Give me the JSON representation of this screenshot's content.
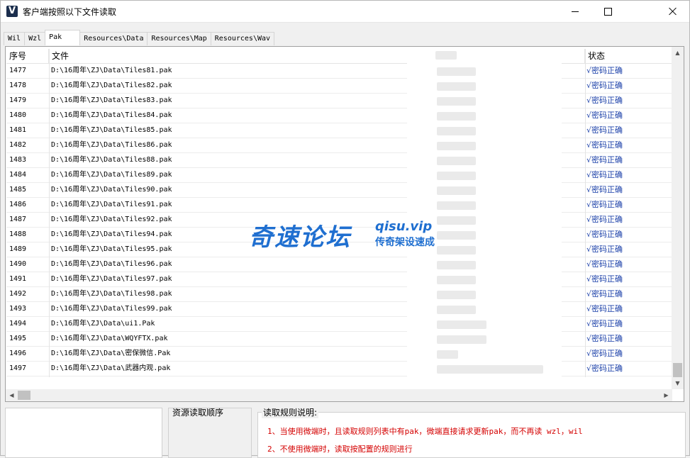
{
  "window": {
    "title": "客户端按照以下文件读取",
    "icon_letter": "V"
  },
  "tabs": [
    {
      "label": "Wil",
      "active": false
    },
    {
      "label": "Wzl",
      "active": false
    },
    {
      "label": "Pak",
      "active": true
    },
    {
      "label": "Resources\\Data",
      "active": false
    },
    {
      "label": "Resources\\Map",
      "active": false
    },
    {
      "label": "Resources\\Wav",
      "active": false
    }
  ],
  "table": {
    "columns": {
      "num": "序号",
      "file": "文件",
      "status": "状态"
    },
    "rows": [
      {
        "num": "1477",
        "file": "D:\\16周年\\ZJ\\Data\\Tiles81.pak",
        "status": "√密码正确"
      },
      {
        "num": "1478",
        "file": "D:\\16周年\\ZJ\\Data\\Tiles82.pak",
        "status": "√密码正确"
      },
      {
        "num": "1479",
        "file": "D:\\16周年\\ZJ\\Data\\Tiles83.pak",
        "status": "√密码正确"
      },
      {
        "num": "1480",
        "file": "D:\\16周年\\ZJ\\Data\\Tiles84.pak",
        "status": "√密码正确"
      },
      {
        "num": "1481",
        "file": "D:\\16周年\\ZJ\\Data\\Tiles85.pak",
        "status": "√密码正确"
      },
      {
        "num": "1482",
        "file": "D:\\16周年\\ZJ\\Data\\Tiles86.pak",
        "status": "√密码正确"
      },
      {
        "num": "1483",
        "file": "D:\\16周年\\ZJ\\Data\\Tiles88.pak",
        "status": "√密码正确"
      },
      {
        "num": "1484",
        "file": "D:\\16周年\\ZJ\\Data\\Tiles89.pak",
        "status": "√密码正确"
      },
      {
        "num": "1485",
        "file": "D:\\16周年\\ZJ\\Data\\Tiles90.pak",
        "status": "√密码正确"
      },
      {
        "num": "1486",
        "file": "D:\\16周年\\ZJ\\Data\\Tiles91.pak",
        "status": "√密码正确"
      },
      {
        "num": "1487",
        "file": "D:\\16周年\\ZJ\\Data\\Tiles92.pak",
        "status": "√密码正确"
      },
      {
        "num": "1488",
        "file": "D:\\16周年\\ZJ\\Data\\Tiles94.pak",
        "status": "√密码正确"
      },
      {
        "num": "1489",
        "file": "D:\\16周年\\ZJ\\Data\\Tiles95.pak",
        "status": "√密码正确"
      },
      {
        "num": "1490",
        "file": "D:\\16周年\\ZJ\\Data\\Tiles96.pak",
        "status": "√密码正确"
      },
      {
        "num": "1491",
        "file": "D:\\16周年\\ZJ\\Data\\Tiles97.pak",
        "status": "√密码正确"
      },
      {
        "num": "1492",
        "file": "D:\\16周年\\ZJ\\Data\\Tiles98.pak",
        "status": "√密码正确"
      },
      {
        "num": "1493",
        "file": "D:\\16周年\\ZJ\\Data\\Tiles99.pak",
        "status": "√密码正确"
      },
      {
        "num": "1494",
        "file": "D:\\16周年\\ZJ\\Data\\ui1.Pak",
        "status": "√密码正确"
      },
      {
        "num": "1495",
        "file": "D:\\16周年\\ZJ\\Data\\WQYFTX.pak",
        "status": "√密码正确"
      },
      {
        "num": "1496",
        "file": "D:\\16周年\\ZJ\\Data\\密保微信.Pak",
        "status": "√密码正确"
      },
      {
        "num": "1497",
        "file": "D:\\16周年\\ZJ\\Data\\武器内观.pak",
        "status": "√密码正确"
      }
    ]
  },
  "watermark": {
    "main": "奇速论坛",
    "url": "qisu.vip",
    "sub": "传奇架设速成"
  },
  "bottom": {
    "order_label": "资源读取顺序",
    "rules_title": "读取规则说明:",
    "rule1": "1、当使用微端时，且读取规则列表中有pak，微端直接请求更新pak，而不再读 wzl，wil",
    "rule2": "2、不使用微端时，读取按配置的规则进行"
  },
  "colors": {
    "status_text": "#1a3fa8",
    "rule_text": "#d40000",
    "watermark": "#1f6fd0"
  }
}
